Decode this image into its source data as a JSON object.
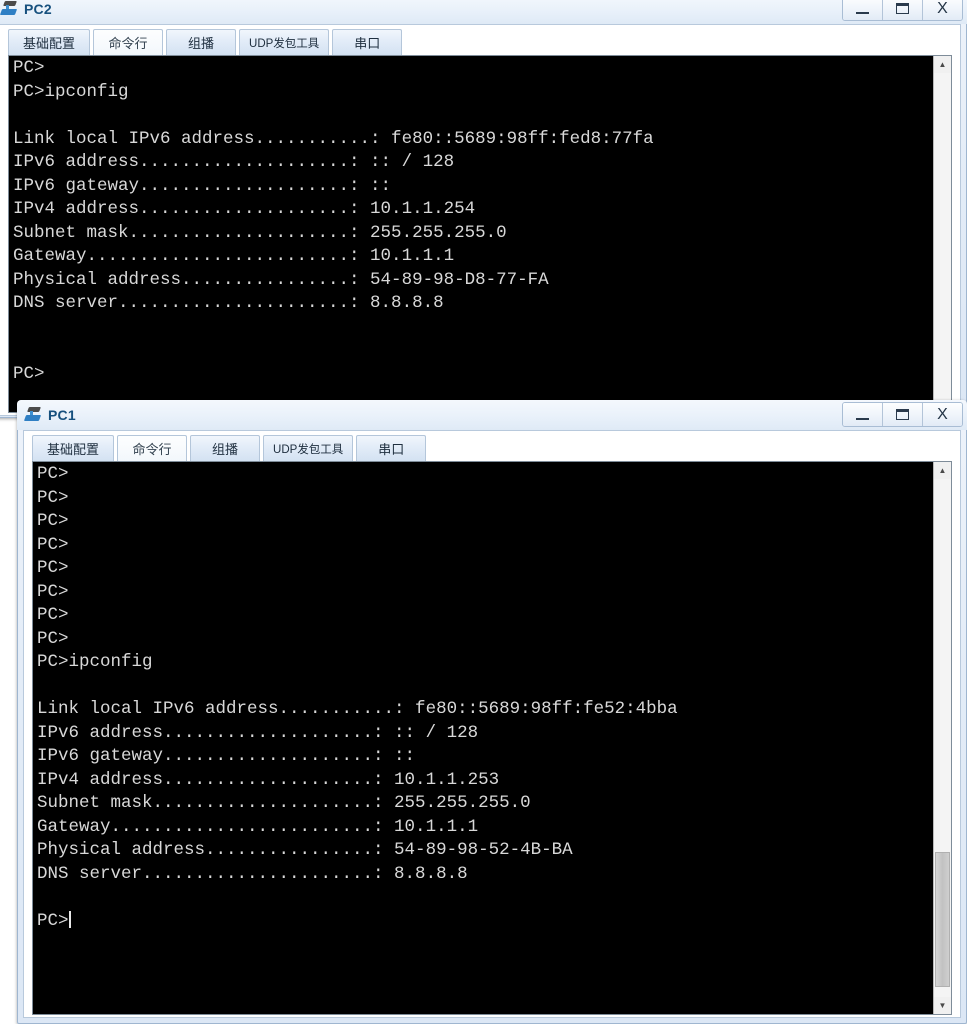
{
  "app": {
    "icon": "computer-icon"
  },
  "window_controls": {
    "minimize": "minimize-button",
    "maximize": "maximize-button",
    "close_label": "X"
  },
  "tabs": [
    {
      "label": "基础配置",
      "active": false
    },
    {
      "label": "命令行",
      "active": true
    },
    {
      "label": "组播",
      "active": false
    },
    {
      "label": "UDP发包工具",
      "active": false
    },
    {
      "label": "串口",
      "active": false
    }
  ],
  "pc2": {
    "title": "PC2",
    "console_text": "PC>\nPC>ipconfig\n\nLink local IPv6 address...........: fe80::5689:98ff:fed8:77fa\nIPv6 address....................: :: / 128\nIPv6 gateway....................: ::\nIPv4 address....................: 10.1.1.254\nSubnet mask.....................: 255.255.255.0\nGateway.........................: 10.1.1.1\nPhysical address................: 54-89-98-D8-77-FA\nDNS server......................: 8.8.8.8\n\n\nPC>",
    "ipconfig": {
      "command": "ipconfig",
      "prompt": "PC>",
      "link_local_ipv6_label": "Link local IPv6 address...........:",
      "link_local_ipv6_value": "fe80::5689:98ff:fed8:77fa",
      "ipv6_address_label": "IPv6 address....................:",
      "ipv6_address_value": ":: / 128",
      "ipv6_gateway_label": "IPv6 gateway....................:",
      "ipv6_gateway_value": "::",
      "ipv4_address_label": "IPv4 address....................:",
      "ipv4_address_value": "10.1.1.254",
      "subnet_mask_label": "Subnet mask.....................:",
      "subnet_mask_value": "255.255.255.0",
      "gateway_label": "Gateway.........................:",
      "gateway_value": "10.1.1.1",
      "physical_address_label": "Physical address................:",
      "physical_address_value": "54-89-98-D8-77-FA",
      "dns_server_label": "DNS server......................:",
      "dns_server_value": "8.8.8.8"
    }
  },
  "pc1": {
    "title": "PC1",
    "console_text": "PC>\nPC>\nPC>\nPC>\nPC>\nPC>\nPC>\nPC>\nPC>ipconfig\n\nLink local IPv6 address...........: fe80::5689:98ff:fe52:4bba\nIPv6 address....................: :: / 128\nIPv6 gateway....................: ::\nIPv4 address....................: 10.1.1.253\nSubnet mask.....................: 255.255.255.0\nGateway.........................: 10.1.1.1\nPhysical address................: 54-89-98-52-4B-BA\nDNS server......................: 8.8.8.8\n\n\n",
    "prompt_line": "PC>",
    "ipconfig": {
      "command": "ipconfig",
      "prompt": "PC>",
      "link_local_ipv6_label": "Link local IPv6 address...........:",
      "link_local_ipv6_value": "fe80::5689:98ff:fe52:4bba",
      "ipv6_address_label": "IPv6 address....................:",
      "ipv6_address_value": ":: / 128",
      "ipv6_gateway_label": "IPv6 gateway....................:",
      "ipv6_gateway_value": "::",
      "ipv4_address_label": "IPv4 address....................:",
      "ipv4_address_value": "10.1.1.253",
      "subnet_mask_label": "Subnet mask.....................:",
      "subnet_mask_value": "255.255.255.0",
      "gateway_label": "Gateway.........................:",
      "gateway_value": "10.1.1.1",
      "physical_address_label": "Physical address................:",
      "physical_address_value": "54-89-98-52-4B-BA",
      "dns_server_label": "DNS server......................:",
      "dns_server_value": "8.8.8.8"
    }
  },
  "colors": {
    "console_bg": "#000000",
    "console_text": "#d8d8d8",
    "title_text": "#16507e",
    "window_bg": "#e3ecf7"
  }
}
